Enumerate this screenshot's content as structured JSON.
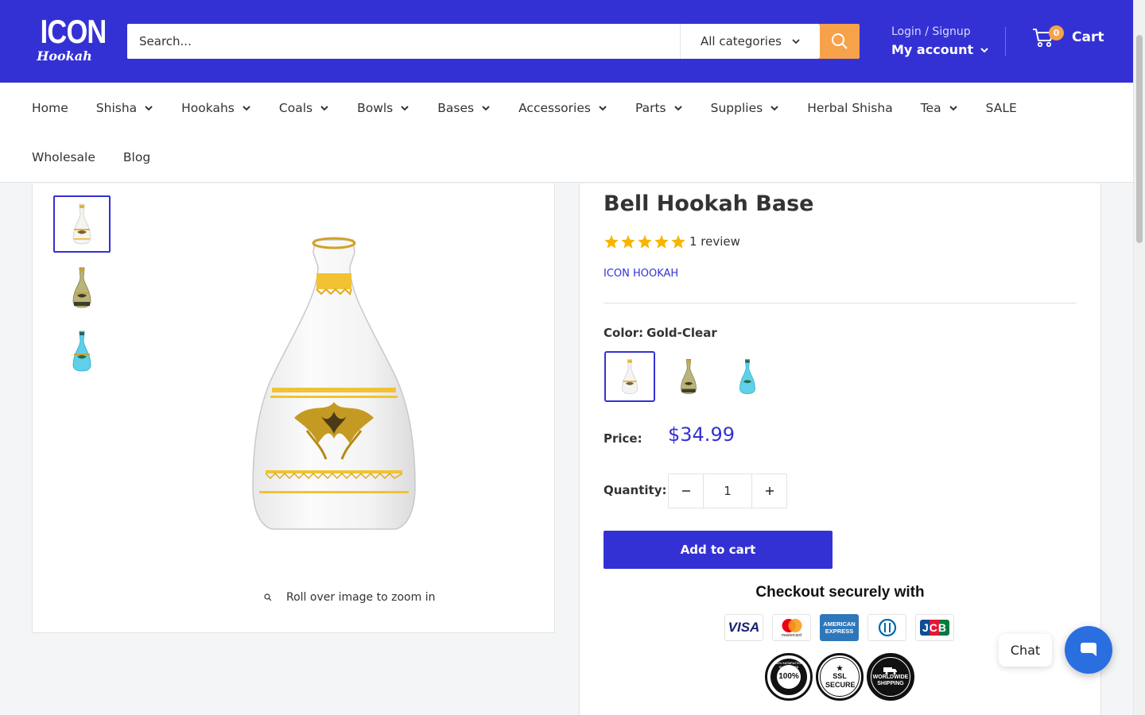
{
  "brand": {
    "logo_line1": "ICON",
    "logo_line2": "Hookah",
    "primary_color": "#3431d4",
    "accent_color": "#f6a24a"
  },
  "header": {
    "search_placeholder": "Search...",
    "category_select": "All categories",
    "search_icon": "magnifier-icon",
    "login_label": "Login / Signup",
    "account_label": "My account",
    "cart_count": "0",
    "cart_label": "Cart"
  },
  "nav": {
    "items": [
      {
        "label": "Home",
        "dropdown": false
      },
      {
        "label": "Shisha",
        "dropdown": true
      },
      {
        "label": "Hookahs",
        "dropdown": true
      },
      {
        "label": "Coals",
        "dropdown": true
      },
      {
        "label": "Bowls",
        "dropdown": true
      },
      {
        "label": "Bases",
        "dropdown": true
      },
      {
        "label": "Accessories",
        "dropdown": true
      },
      {
        "label": "Parts",
        "dropdown": true
      },
      {
        "label": "Supplies",
        "dropdown": true
      },
      {
        "label": "Herbal Shisha",
        "dropdown": false
      },
      {
        "label": "Tea",
        "dropdown": true
      },
      {
        "label": "SALE",
        "dropdown": false
      },
      {
        "label": "Wholesale",
        "dropdown": false
      },
      {
        "label": "Blog",
        "dropdown": false
      }
    ]
  },
  "gallery": {
    "thumbnails": [
      "Gold-Clear",
      "Gold-Dark",
      "Blue"
    ],
    "active_index": 0,
    "zoom_hint": "Roll over image to zoom in"
  },
  "product": {
    "title": "Bell Hookah Base",
    "rating": 5,
    "review_text": "1 review",
    "vendor": "ICON HOOKAH",
    "color_label": "Color:",
    "color_value": "Gold-Clear",
    "price_label": "Price:",
    "price": "$34.99",
    "quantity_label": "Quantity:",
    "quantity": "1",
    "add_to_cart": "Add to cart",
    "checkout_title": "Checkout securely with",
    "payment_cards": [
      "VISA",
      "mastercard",
      "AMERICAN EXPRESS",
      "Diners Club",
      "JCB"
    ],
    "trust_badges": [
      "100% SATISFACTION GUARANTEED",
      "SSL SECURE",
      "WORLDWIDE SHIPPING"
    ]
  },
  "chat": {
    "label": "Chat"
  }
}
